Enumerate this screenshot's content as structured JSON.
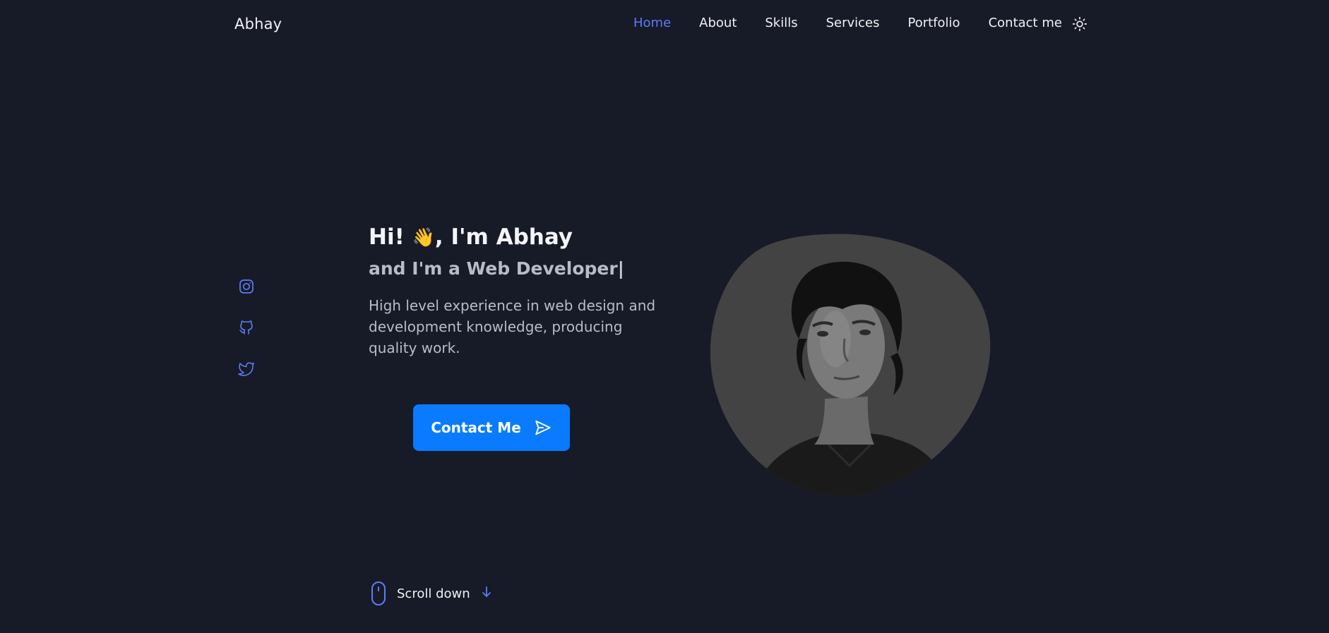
{
  "header": {
    "logo": "Abhay",
    "nav": [
      {
        "label": "Home",
        "active": true
      },
      {
        "label": "About"
      },
      {
        "label": "Skills"
      },
      {
        "label": "Services"
      },
      {
        "label": "Portfolio"
      },
      {
        "label": "Contact me"
      }
    ],
    "theme_icon": "sun-icon"
  },
  "social": [
    {
      "name": "instagram-icon"
    },
    {
      "name": "github-icon"
    },
    {
      "name": "twitter-icon"
    }
  ],
  "hero": {
    "greeting_prefix": "Hi!",
    "greeting_emoji": "👋",
    "greeting_suffix": ", I'm Abhay",
    "subtitle": "and I'm a Web Developer",
    "subtitle_cursor": "|",
    "description": "High level experience in web design and development knowledge, producing quality work.",
    "button_label": "Contact Me"
  },
  "scroll": {
    "label": "Scroll down"
  },
  "colors": {
    "background": "#171a27",
    "accent": "#5b7cf7",
    "button": "#0a7bff",
    "blob": "#434343"
  }
}
